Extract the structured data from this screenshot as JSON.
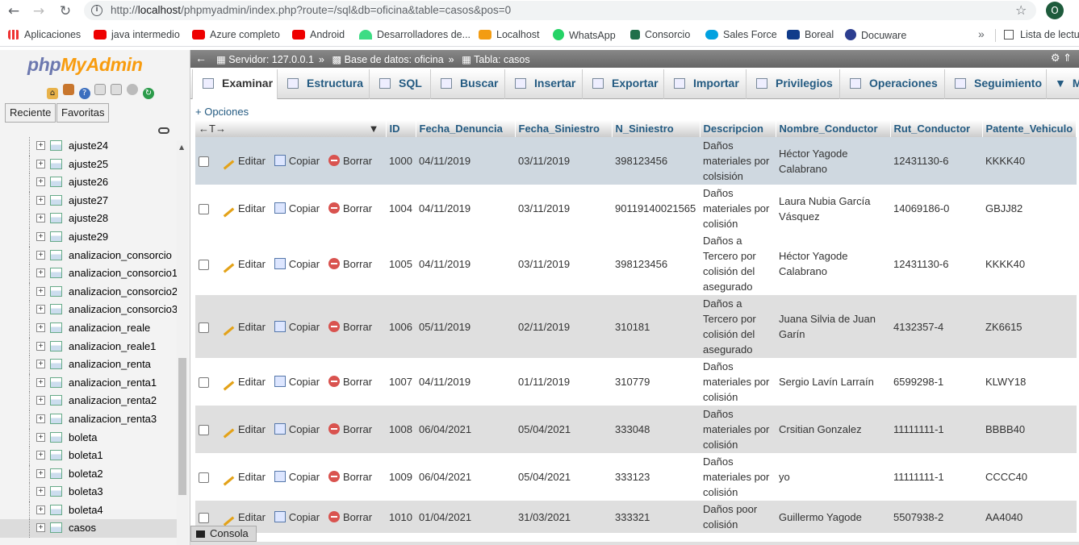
{
  "browser": {
    "url_prefix": "http://",
    "url_host": "localhost",
    "url_path": "/phpmyadmin/index.php?route=/sql&db=oficina&table=casos&pos=0",
    "avatar_letter": "O",
    "bookmarks": [
      "Aplicaciones",
      "java intermedio",
      "Azure completo",
      "Android",
      "Desarrolladores de...",
      "Localhost",
      "WhatsApp",
      "Consorcio",
      "Sales Force",
      "Boreal",
      "Docuware"
    ],
    "more": "»",
    "reading_list": "Lista de lectu"
  },
  "sidebar": {
    "logo_a": "php",
    "logo_b": "MyAdmin",
    "btn_recent": "Reciente",
    "btn_favorites": "Favoritas",
    "tables": [
      "ajuste24",
      "ajuste25",
      "ajuste26",
      "ajuste27",
      "ajuste28",
      "ajuste29",
      "analizacion_consorcio",
      "analizacion_consorcio1",
      "analizacion_consorcio2",
      "analizacion_consorcio3",
      "analizacion_reale",
      "analizacion_reale1",
      "analizacion_renta",
      "analizacion_renta1",
      "analizacion_renta2",
      "analizacion_renta3",
      "boleta",
      "boleta1",
      "boleta2",
      "boleta3",
      "boleta4",
      "casos"
    ]
  },
  "breadcrumb": {
    "server": "Servidor: 127.0.0.1",
    "database": "Base de datos: oficina",
    "table": "Tabla: casos"
  },
  "tabs": [
    "Examinar",
    "Estructura",
    "SQL",
    "Buscar",
    "Insertar",
    "Exportar",
    "Importar",
    "Privilegios",
    "Operaciones",
    "Seguimiento",
    "M"
  ],
  "opciones": "+ Opciones",
  "actions": {
    "edit": "Editar",
    "copy": "Copiar",
    "delete": "Borrar"
  },
  "columns": [
    "ID",
    "Fecha_Denuncia",
    "Fecha_Siniestro",
    "N_Siniestro",
    "Descripcion",
    "Nombre_Conductor",
    "Rut_Conductor",
    "Patente_Vehiculo"
  ],
  "rows": [
    [
      "1000",
      "04/11/2019",
      "03/11/2019",
      "398123456",
      "Daños materiales por colsisión",
      "Héctor Yagode Calabrano",
      "12431130-6",
      "KKKK40"
    ],
    [
      "1004",
      "04/11/2019",
      "03/11/2019",
      "90119140021565",
      "Daños materiales por colisión",
      "Laura Nubia García Vásquez",
      "14069186-0",
      "GBJJ82"
    ],
    [
      "1005",
      "04/11/2019",
      "03/11/2019",
      "398123456",
      "Daños a Tercero por colisión del asegurado",
      "Héctor Yagode Calabrano",
      "12431130-6",
      "KKKK40"
    ],
    [
      "1006",
      "05/11/2019",
      "02/11/2019",
      "310181",
      "Daños a Tercero por colisión del asegurado",
      "Juana Silvia de Juan Garín",
      "4132357-4",
      "ZK6615"
    ],
    [
      "1007",
      "04/11/2019",
      "01/11/2019",
      "310779",
      "Daños materiales por colisión",
      "Sergio Lavín Larraín",
      "6599298-1",
      "KLWY18"
    ],
    [
      "1008",
      "06/04/2021",
      "05/04/2021",
      "333048",
      "Daños materiales por colisión",
      "Crsitian Gonzalez",
      "11111111-1",
      "BBBB40"
    ],
    [
      "1009",
      "06/04/2021",
      "05/04/2021",
      "333123",
      "Daños materiales por colisión",
      "yo",
      "11111111-1",
      "CCCC40"
    ],
    [
      "1010",
      "01/04/2021",
      "31/03/2021",
      "333321",
      "Daños poor colisión",
      "Guillermo Yagode",
      "5507938-2",
      "AA4040"
    ]
  ],
  "console": "Consola"
}
